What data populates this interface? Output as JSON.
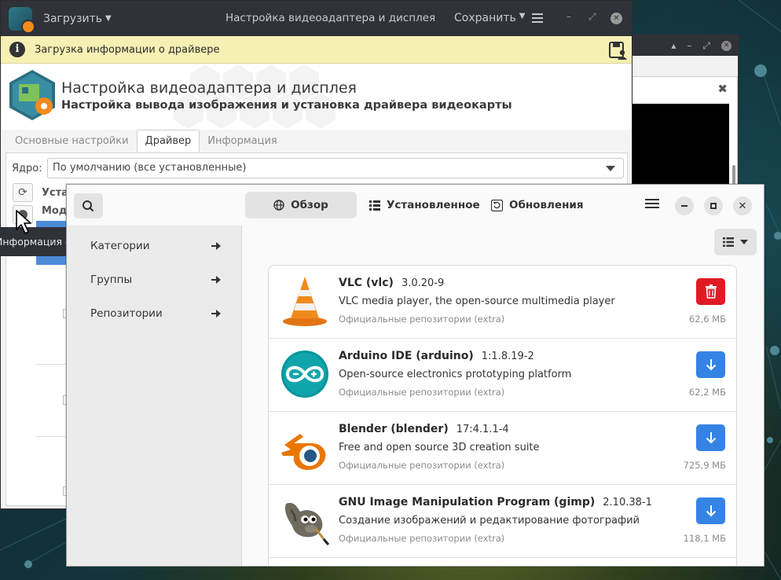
{
  "driver_window": {
    "titlebar": {
      "load_menu": "Загрузить",
      "title": "Настройка видеоадаптера и дисплея",
      "save_menu": "Сохранить"
    },
    "info_bar": "Загрузка информации о драйвере",
    "header": {
      "title": "Настройка видеоадаптера и дисплея",
      "subtitle": "Настройка вывода изображения и установка драйвера видеокарты"
    },
    "tabs": [
      "Основные настройки",
      "Драйвер",
      "Информация"
    ],
    "active_tab": "Драйвер",
    "kernel_label": "Ядро:",
    "kernel_value": "По умолчанию (все установленные)",
    "install_label": "Устан",
    "modules_label": "Моду",
    "tooltip": "Информация о драйвере"
  },
  "package_manager": {
    "tabs": [
      {
        "label": "Обзор",
        "icon": "globe-icon",
        "active": true
      },
      {
        "label": "Установленное",
        "icon": "list-icon",
        "active": false
      },
      {
        "label": "Обновления",
        "icon": "refresh-icon",
        "active": false
      }
    ],
    "sidebar": [
      {
        "label": "Категории"
      },
      {
        "label": "Группы"
      },
      {
        "label": "Репозитории"
      }
    ],
    "packages": [
      {
        "name": "VLC (vlc)",
        "version": "3.0.20-9",
        "description": "VLC media player, the open-source multimedia player",
        "repo": "Официальные репозитории (extra)",
        "size": "62,6 МБ",
        "action": "remove"
      },
      {
        "name": "Arduino IDE (arduino)",
        "version": "1:1.8.19-2",
        "description": "Open-source electronics prototyping platform",
        "repo": "Официальные репозитории (extra)",
        "size": "62,2 МБ",
        "action": "install"
      },
      {
        "name": "Blender (blender)",
        "version": "17:4.1.1-4",
        "description": "Free and open source 3D creation suite",
        "repo": "Официальные репозитории (extra)",
        "size": "725,9 МБ",
        "action": "install"
      },
      {
        "name": "GNU Image Manipulation Program (gimp)",
        "version": "2.10.38-1",
        "description": "Создание изображений и редактирование фотографий",
        "repo": "Официальные репозитории (extra)",
        "size": "118,1 МБ",
        "action": "install"
      }
    ]
  },
  "colors": {
    "install_button": "#3584e4",
    "remove_button": "#e01b24",
    "info_bar": "#f7f0b4",
    "titlebar": "#2f3238"
  }
}
